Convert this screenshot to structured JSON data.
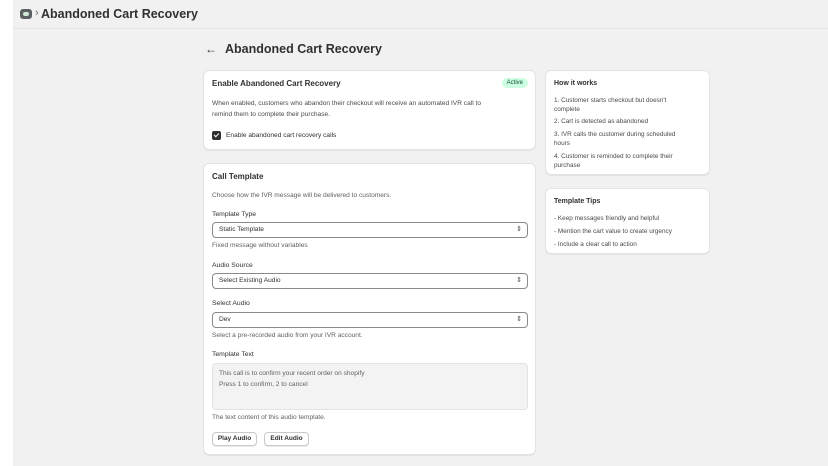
{
  "topbar": {
    "icon": "app-logo-icon",
    "separator": "›",
    "title": "Abandoned Cart Recovery"
  },
  "header": {
    "back_icon": "←",
    "title": "Abandoned Cart Recovery"
  },
  "enable_card": {
    "title": "Enable Abandoned Cart Recovery",
    "badge": "Active",
    "description_line1": "When enabled, customers who abandon their checkout will receive an automated IVR call to",
    "description_line2": "remind them to complete their purchase.",
    "checkbox_label": "Enable abandoned cart recovery calls",
    "checkbox_checked": true
  },
  "template_card": {
    "title": "Call Template",
    "description": "Choose how the IVR message will be delivered to customers.",
    "template_type": {
      "label": "Template Type",
      "value": "Static Template",
      "help": "Fixed message without variables"
    },
    "audio_source": {
      "label": "Audio Source",
      "value": "Select Existing Audio"
    },
    "select_audio": {
      "label": "Select Audio",
      "value": "Dev",
      "help": "Select a pre-recorded audio from your IVR account."
    },
    "template_text": {
      "label": "Template Text",
      "line1": "This call is to confirm your recent order on shopify",
      "line2": "Press 1 to confirm, 2 to cancel",
      "help": "The text content of this audio template."
    },
    "buttons": {
      "play": "Play Audio",
      "edit": "Edit Audio"
    }
  },
  "how_it_works": {
    "title": "How it works",
    "steps": [
      [
        "1. Customer starts checkout but doesn't",
        "complete"
      ],
      [
        "2. Cart is detected as abandoned"
      ],
      [
        "3. IVR calls the customer during scheduled",
        "hours"
      ],
      [
        "4. Customer is reminded to complete their",
        "purchase"
      ]
    ]
  },
  "template_tips": {
    "title": "Template Tips",
    "tips": [
      "- Keep messages friendly and helpful",
      "- Mention the cart value to create urgency",
      "- Include a clear call to action"
    ]
  },
  "colors": {
    "page_bg": "#f1f1f1",
    "card_bg": "#ffffff",
    "badge_bg": "#cdfee1",
    "badge_text": "#0c5132",
    "text": "#303030"
  }
}
